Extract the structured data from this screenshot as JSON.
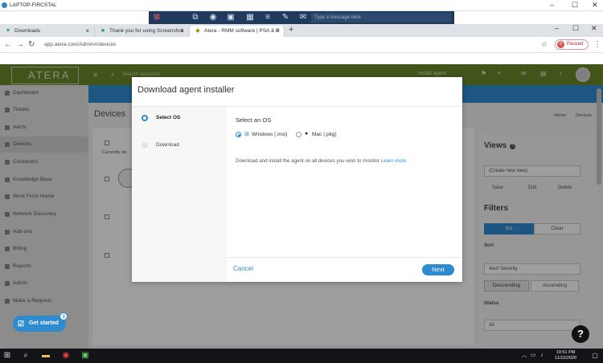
{
  "rdp": {
    "title": "LAPTOP-FIRCSTAL"
  },
  "remote_toolbar": {
    "message_placeholder": "Type a message here"
  },
  "browser": {
    "tabs": [
      {
        "label": "Downloads"
      },
      {
        "label": "Thank you for using Screenshot"
      },
      {
        "label": "Atera - RMM software | PSA & R"
      }
    ],
    "new_tab": "+",
    "url": "app.atera.com/Admin#/devices",
    "profile": {
      "initial": "D",
      "status": "Paused"
    }
  },
  "app": {
    "logo": "ATERA",
    "search_placeholder": "Search keyword",
    "install_agent": "Install agent"
  },
  "sidebar": {
    "items": [
      {
        "label": "Dashboard"
      },
      {
        "label": "Tickets"
      },
      {
        "label": "Alerts"
      },
      {
        "label": "Devices"
      },
      {
        "label": "Customers"
      },
      {
        "label": "Knowledge Base"
      },
      {
        "label": "Work From Home"
      },
      {
        "label": "Network Discovery"
      },
      {
        "label": "Add-ons"
      },
      {
        "label": "Billing"
      },
      {
        "label": "Reports"
      },
      {
        "label": "Admin"
      },
      {
        "label": "Make a Request"
      }
    ],
    "get_started": "Get started",
    "get_started_badge": "3"
  },
  "page": {
    "title": "Devices",
    "breadcrumb": [
      "Home",
      "Devices"
    ],
    "currently_label": "Currently dis"
  },
  "right_panel": {
    "views_title": "Views",
    "create_view": "(Create new view)",
    "save": "Save",
    "edit": "Edit",
    "delete": "Delete",
    "filters_title": "Filters",
    "go": "Go",
    "clear": "Clear",
    "sort_label": "Sort",
    "sort_value": "Alert Severity",
    "descending": "Descending",
    "ascending": "Ascending",
    "status_label": "Status",
    "status_value": "All"
  },
  "modal": {
    "title": "Download agent installer",
    "steps": [
      {
        "label": "Select OS"
      },
      {
        "label": "Download"
      }
    ],
    "section_title": "Select an OS",
    "options": [
      {
        "label": "Windows (.msi)",
        "selected": true
      },
      {
        "label": "Mac (.pkg)",
        "selected": false
      }
    ],
    "description": "Download and install the agent on all devices you wish to monitor",
    "learn_more": "Learn more",
    "cancel": "Cancel",
    "next": "Next"
  },
  "taskbar": {
    "time": "10:51 PM",
    "date": "11/10/2020"
  },
  "colors": {
    "accent": "#2e8bd0",
    "header_green": "#6a8a2a",
    "taskbar": "#121418"
  }
}
